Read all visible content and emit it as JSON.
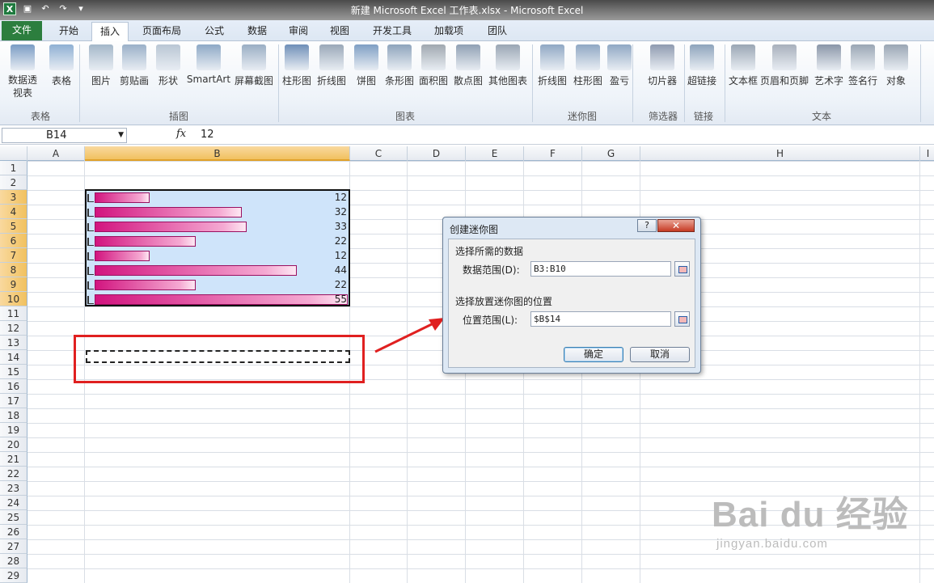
{
  "window": {
    "title": "新建 Microsoft Excel 工作表.xlsx - Microsoft Excel",
    "app_icon": "X"
  },
  "tabs": [
    "文件",
    "开始",
    "插入",
    "页面布局",
    "公式",
    "数据",
    "审阅",
    "视图",
    "开发工具",
    "加载项",
    "团队"
  ],
  "active_tab": "插入",
  "ribbon": {
    "buttons": [
      "数据透视表",
      "表格",
      "图片",
      "剪贴画",
      "形状",
      "SmartArt",
      "屏幕截图",
      "柱形图",
      "折线图",
      "饼图",
      "条形图",
      "面积图",
      "散点图",
      "其他图表",
      "折线图",
      "柱形图",
      "盈亏",
      "切片器",
      "超链接",
      "文本框",
      "页眉和页脚",
      "艺术字",
      "签名行",
      "对象"
    ],
    "groups": [
      "表格",
      "插图",
      "图表",
      "迷你图",
      "筛选器",
      "链接",
      "文本"
    ]
  },
  "formula_bar": {
    "name_box": "B14",
    "fx": "fx",
    "value": "12"
  },
  "columns": [
    "A",
    "B",
    "C",
    "D",
    "E",
    "F",
    "G",
    "H",
    "I"
  ],
  "selected_column": "B",
  "rows": [
    "1",
    "2",
    "3",
    "4",
    "5",
    "6",
    "7",
    "8",
    "9",
    "10",
    "11",
    "12",
    "13",
    "14",
    "15",
    "16",
    "17",
    "18",
    "19",
    "20",
    "21",
    "22",
    "23",
    "24",
    "25",
    "26",
    "27",
    "28",
    "29"
  ],
  "cells": [
    {
      "row": 3,
      "value": "12"
    },
    {
      "row": 4,
      "value": "32"
    },
    {
      "row": 5,
      "value": "33"
    },
    {
      "row": 6,
      "value": "22"
    },
    {
      "row": 7,
      "value": "12"
    },
    {
      "row": 8,
      "value": "44"
    },
    {
      "row": 9,
      "value": "22"
    },
    {
      "row": 10,
      "value": "55"
    }
  ],
  "data_bar_max": 55,
  "dialog": {
    "title": "创建迷你图",
    "help": "?",
    "close": "✕",
    "section1": "选择所需的数据",
    "data_range_label": "数据范围(D):",
    "data_range_value": "B3:B10",
    "section2": "选择放置迷你图的位置",
    "location_label": "位置范围(L):",
    "location_value": "$B$14",
    "ok": "确定",
    "cancel": "取消"
  },
  "watermark": {
    "big": "Bai du 经验",
    "small": "jingyan.baidu.com"
  },
  "colors": {
    "bar": "#d2147f",
    "highlight": "#e02020",
    "file_tab": "#2c7e3e"
  }
}
